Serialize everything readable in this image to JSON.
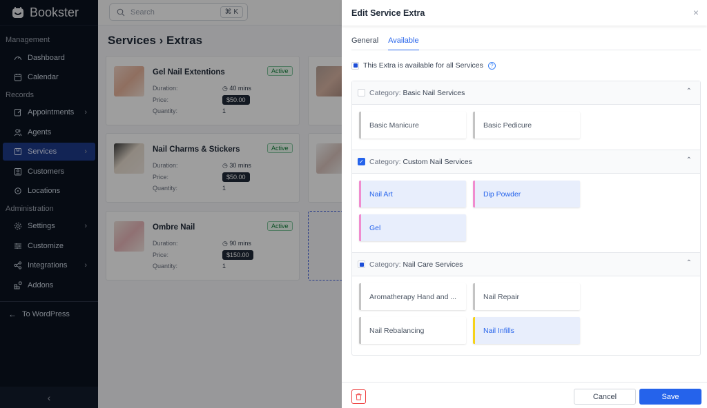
{
  "app": {
    "brand": "Bookster"
  },
  "sidebar": {
    "sections": [
      {
        "label": "Management"
      },
      {
        "label": "Records"
      },
      {
        "label": "Administration"
      }
    ],
    "items": [
      {
        "label": "Dashboard",
        "icon": "dashboard-icon"
      },
      {
        "label": "Calendar",
        "icon": "calendar-icon"
      },
      {
        "label": "Appointments",
        "icon": "appointments-icon",
        "has_submenu": true
      },
      {
        "label": "Agents",
        "icon": "agents-icon"
      },
      {
        "label": "Services",
        "icon": "services-icon",
        "has_submenu": true,
        "active": true
      },
      {
        "label": "Customers",
        "icon": "customers-icon"
      },
      {
        "label": "Locations",
        "icon": "location-icon"
      },
      {
        "label": "Settings",
        "icon": "gear-icon",
        "has_submenu": true
      },
      {
        "label": "Customize",
        "icon": "sliders-icon"
      },
      {
        "label": "Integrations",
        "icon": "share-icon",
        "has_submenu": true
      },
      {
        "label": "Addons",
        "icon": "addons-icon"
      }
    ],
    "back_link": "To WordPress",
    "collapse": "‹",
    "chevron": "›"
  },
  "topbar": {
    "search_placeholder": "Search",
    "shortcut": "⌘ K"
  },
  "main": {
    "title": "Services › Extras",
    "cards": [
      {
        "name": "Gel Nail Extentions",
        "status": "Active",
        "duration_label": "Duration:",
        "duration": "40 mins",
        "price_label": "Price:",
        "price": "$50.00",
        "quantity_label": "Quantity:",
        "quantity": "1"
      },
      {
        "name": "Nail Charms & Stickers",
        "status": "Active",
        "duration_label": "Duration:",
        "duration": "30 mins",
        "price_label": "Price:",
        "price": "$50.00",
        "quantity_label": "Quantity:",
        "quantity": "1"
      },
      {
        "name": "Ombre Nail",
        "status": "Active",
        "duration_label": "Duration:",
        "duration": "90 mins",
        "price_label": "Price:",
        "price": "$150.00",
        "quantity_label": "Quantity:",
        "quantity": "1"
      }
    ]
  },
  "drawer": {
    "title": "Edit Service Extra",
    "close": "×",
    "tabs": [
      {
        "label": "General",
        "active": false
      },
      {
        "label": "Available",
        "active": true
      }
    ],
    "all_services_label": "This Extra is available for all Services",
    "help": "?",
    "category_prefix": "Category:",
    "categories": [
      {
        "name": "Basic Nail Services",
        "state": "unchecked",
        "services": [
          {
            "name": "Basic Manicure",
            "selected": false
          },
          {
            "name": "Basic Pedicure",
            "selected": false
          }
        ]
      },
      {
        "name": "Custom Nail Services",
        "state": "checked",
        "services": [
          {
            "name": "Nail Art",
            "selected": true
          },
          {
            "name": "Dip Powder",
            "selected": true
          },
          {
            "name": "Gel",
            "selected": true
          }
        ]
      },
      {
        "name": "Nail Care Services",
        "state": "indeterminate",
        "services": [
          {
            "name": "Aromatherapy Hand and ...",
            "selected": false
          },
          {
            "name": "Nail Repair",
            "selected": false
          },
          {
            "name": "Nail Rebalancing",
            "selected": false
          },
          {
            "name": "Nail Infills",
            "selected": true
          }
        ]
      }
    ],
    "footer": {
      "cancel": "Cancel",
      "save": "Save"
    }
  },
  "colors": {
    "accent": "#2563eb",
    "sidebar_bg": "#0b1220",
    "active_nav": "#1e3a8a",
    "danger": "#ef4444",
    "selected_bg": "#e8eefc"
  }
}
